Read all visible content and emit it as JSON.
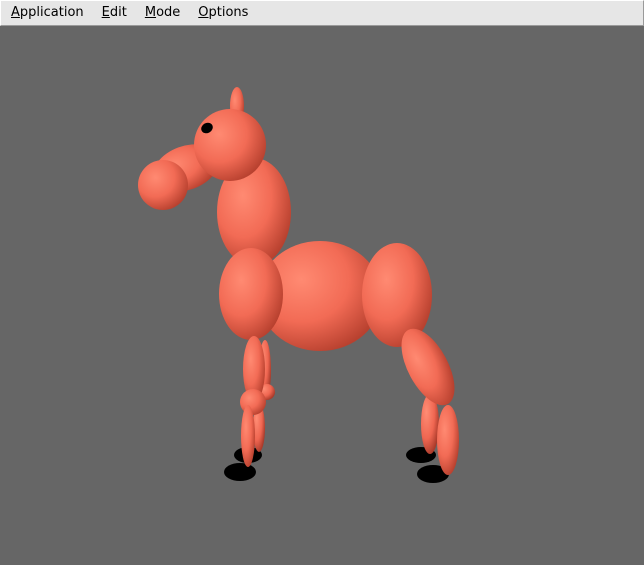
{
  "menubar": {
    "items": [
      {
        "mnemonic": "A",
        "rest": "pplication"
      },
      {
        "mnemonic": "E",
        "rest": "dit"
      },
      {
        "mnemonic": "M",
        "rest": "ode"
      },
      {
        "mnemonic": "O",
        "rest": "ptions"
      }
    ]
  },
  "scene": {
    "background_color": "#666666",
    "model": "horse-icon",
    "body_color": "#f26b55",
    "shadow_color": "#000000",
    "eye_color": "#000000"
  }
}
